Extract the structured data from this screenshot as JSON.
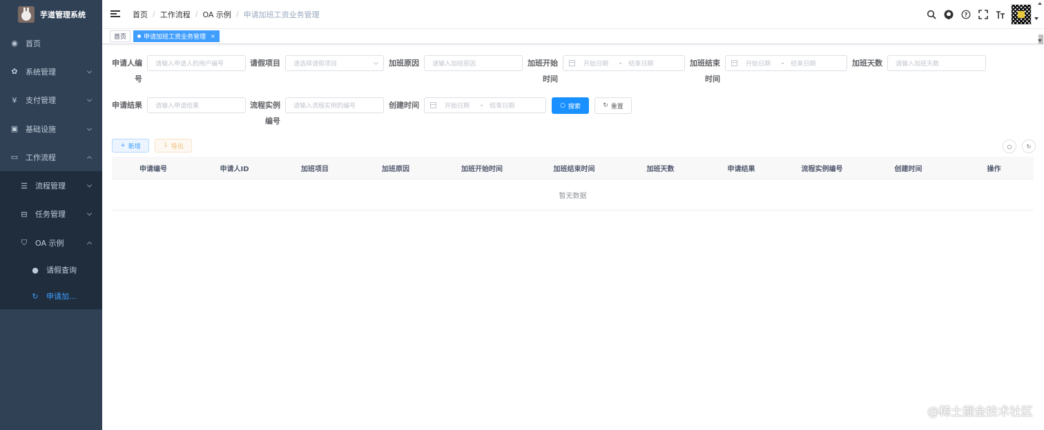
{
  "app": {
    "title": "芋道管理系统"
  },
  "sidebar": {
    "items": [
      {
        "label": "首页",
        "icon": "dashboard-icon"
      },
      {
        "label": "系统管理",
        "icon": "gear-icon"
      },
      {
        "label": "支付管理",
        "icon": "yen-icon"
      },
      {
        "label": "基础设施",
        "icon": "monitor-icon"
      },
      {
        "label": "工作流程",
        "icon": "briefcase-icon"
      }
    ],
    "workflow_children": [
      {
        "label": "流程管理",
        "icon": "list-icon"
      },
      {
        "label": "任务管理",
        "icon": "task-icon"
      },
      {
        "label": "OA 示例",
        "icon": "oa-icon"
      }
    ],
    "oa_children": [
      {
        "label": "请假查询",
        "icon": "user-icon"
      },
      {
        "label": "申请加...",
        "icon": "refresh-icon"
      }
    ]
  },
  "breadcrumb": [
    "首页",
    "工作流程",
    "OA 示例",
    "申请加班工资业务管理"
  ],
  "breadcrumb_sep": "/",
  "tags": [
    {
      "label": "首页"
    },
    {
      "label": "申请加班工资业务管理",
      "close": "×"
    }
  ],
  "form": {
    "applicant_no": {
      "label": "申请人编号",
      "placeholder": "请输入申请人的用户编号"
    },
    "leave_item": {
      "label": "请假项目",
      "placeholder": "请选择请假项目"
    },
    "overtime_reason": {
      "label": "加班原因",
      "placeholder": "请输入加班原因"
    },
    "overtime_start": {
      "label": "加班开始时间",
      "start": "开始日期",
      "end": "结束日期"
    },
    "overtime_end": {
      "label": "加班结束时间",
      "start": "开始日期",
      "end": "结束日期"
    },
    "overtime_days": {
      "label": "加班天数",
      "placeholder": "请输入加班天数"
    },
    "apply_result": {
      "label": "申请结果",
      "placeholder": "请输入申请结果"
    },
    "process_instance": {
      "label": "流程实例编号",
      "placeholder": "请输入流程实例的编号"
    },
    "create_time": {
      "label": "创建时间",
      "start": "开始日期",
      "end": "结束日期"
    },
    "range_sep": "-",
    "search_label": "搜索",
    "reset_label": "重置"
  },
  "toolbar": {
    "add_label": "新增",
    "export_label": "导出"
  },
  "table": {
    "columns": [
      "申请编号",
      "申请人ID",
      "加班项目",
      "加班原因",
      "加班开始时间",
      "加班结束时间",
      "加班天数",
      "申请结果",
      "流程实例编号",
      "创建时间",
      "操作"
    ],
    "empty_text": "暂无数据"
  },
  "watermark": "@稀土掘金技术社区"
}
